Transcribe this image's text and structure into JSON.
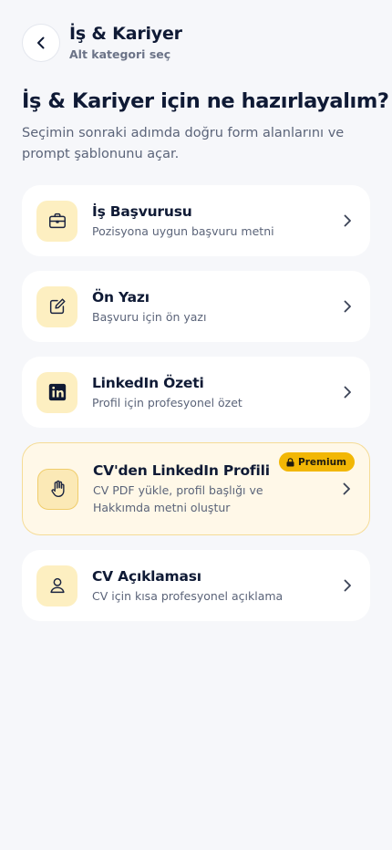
{
  "header": {
    "back_icon": "chevron-left-icon",
    "title": "İş & Kariyer",
    "subtitle": "Alt kategori seç"
  },
  "page": {
    "title": "İş & Kariyer için ne hazırlayalım?",
    "description": "Seçimin sonraki adımda doğru form alanlarını ve prompt şablonunu açar."
  },
  "colors": {
    "accent": "#f2b705",
    "icon_bg": "#fdefc1",
    "card_bg": "#ffffff",
    "premium_card_bg": "#fff8e8",
    "page_bg": "#f6f7fa",
    "text_dark": "#0f1a35",
    "text_muted": "#5b6479"
  },
  "items": [
    {
      "title": "İş Başvurusu",
      "subtitle": "Pozisyona uygun başvuru metni",
      "icon": "briefcase-icon"
    },
    {
      "title": "Ön Yazı",
      "subtitle": "Başvuru için ön yazı",
      "icon": "edit-icon"
    },
    {
      "title": "LinkedIn Özeti",
      "subtitle": "Profil için profesyonel özet",
      "icon": "linkedin-icon"
    },
    {
      "title": "CV'den LinkedIn Profili",
      "subtitle": "CV PDF yükle, profil başlığı ve Hakkımda metni oluştur",
      "icon": "hand-icon",
      "badge": "Premium",
      "badge_icon": "lock-icon"
    },
    {
      "title": "CV Açıklaması",
      "subtitle": "CV için kısa profesyonel açıklama",
      "icon": "user-icon"
    }
  ]
}
